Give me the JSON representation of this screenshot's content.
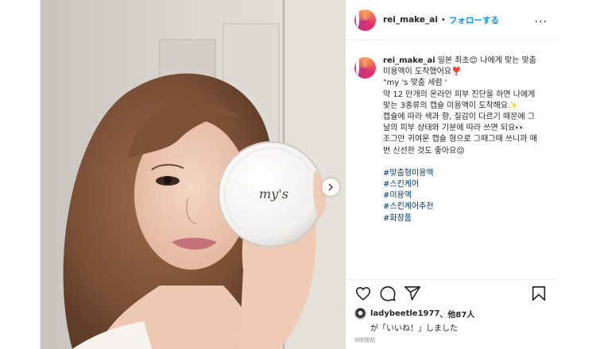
{
  "post": {
    "username": "rei_make_ai",
    "follow_separator": "•",
    "follow_label": "フォローする",
    "more_label": "...",
    "caption": {
      "line1": "일본 최초😊 나에게 맞는 맞춤미용액이 도착했어요❣️",
      "para2": "\"my 's 맞춤 세럼 '\n약 12 만개의 온라인 피부 진단을 하면 나에게 맞는 3종류의 캡슐 미용액이 도착해요✨",
      "para3": "캡슐에 따라 색과 향, 질감이 다르기 때문에 그날의 피부 상태와 기분에 따라 쓰면 되요👀\n조그만 귀여운 캡슐 형으로 그때그때 쓰니까 매번 신선한 것도 좋아요😌",
      "hashtags": [
        "#맞춤형미용액",
        "#스킨케어",
        "#미용액",
        "#스킨케어추천",
        "#화장품"
      ]
    },
    "likes": {
      "first_user": "ladybeetle1977",
      "others": "、他87人",
      "suffix": "が「いいね！」しました"
    },
    "time": "9時間前",
    "product_label": "my's"
  },
  "icons": {
    "like": "heart-icon",
    "comment": "comment-icon",
    "share": "share-icon",
    "save": "bookmark-icon",
    "next": "chevron-right-icon"
  },
  "colors": {
    "link_blue": "#0095f6",
    "hashtag": "#00376b",
    "muted": "#8e8e8e"
  }
}
